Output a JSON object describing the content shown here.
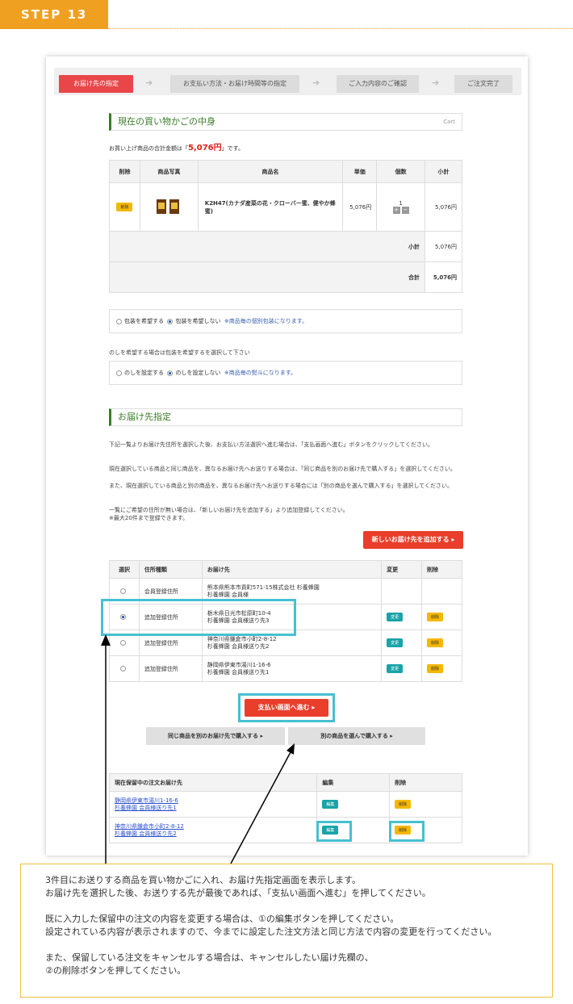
{
  "step": {
    "label": "STEP 13"
  },
  "progress": [
    "お届け先の指定",
    "お支払い方法・お届け時間等の指定",
    "ご入力内容のご確認",
    "ご注文完了"
  ],
  "cart_section": {
    "title": "現在の買い物かごの中身",
    "cart_tag": "Cart",
    "total_prefix": "お買い上げ商品の合計金額は「",
    "total_amount": "5,076円",
    "total_suffix": "」です。",
    "headers": [
      "削除",
      "商品写真",
      "商品名",
      "単価",
      "個数",
      "小計"
    ],
    "item": {
      "delete": "削除",
      "name": "K2H47(カナダ産菜の花・クローバー蜜、健やか蜂蜜)",
      "unit_price": "5,076円",
      "qty": "1",
      "subtotal": "5,076円"
    },
    "subtotal_label": "小計",
    "subtotal_value": "5,076円",
    "grand_label": "合計",
    "grand_value": "5,076円"
  },
  "wrap": {
    "opt1": "包装を希望する",
    "opt2": "包装を希望しない",
    "note": "※商品毎の個別包装になります。"
  },
  "noshi": {
    "hint": "のしを希望する場合は包装を希望するを選択して下さい",
    "opt1": "のしを設定する",
    "opt2": "のしを設定しない",
    "note": "※商品毎の熨斗になります。"
  },
  "delivery": {
    "title": "お届け先指定",
    "p1": "下記一覧よりお届け先住所を選択した後、お支払い方法選択へ進む場合は、「支払画面へ進む」ボタンをクリックしてください。",
    "p2a": "現在選択している商品と同じ商品を、異なるお届け先へお送りする場合は、「同じ商品を別のお届け先で購入する」を選択してください。",
    "p2b": "また、現在選択している商品と別の商品を、異なるお届け先へお送りする場合には「別の商品を選んで購入する」を選択してください。",
    "p3a": "一覧にご希望の住所が無い場合は、「新しいお届け先を追加する」より追加登録してください。",
    "p3b": "※最大20件まで登録できます。",
    "add_button": "新しいお届け先を追加する ▸",
    "headers": [
      "選択",
      "住所種類",
      "お届け先",
      "変更",
      "削除"
    ],
    "rows": [
      {
        "type": "会員登録住所",
        "addr1": "熊本県熊本市貢町571-15株式会社 杉養蜂園",
        "addr2": "杉養蜂園 会員様",
        "edit": "",
        "del": ""
      },
      {
        "type": "追加登録住所",
        "addr1": "栃木県日光市松原町10-4",
        "addr2": "杉養蜂園 会員様送り先3",
        "edit": "変更",
        "del": "削除"
      },
      {
        "type": "追加登録住所",
        "addr1": "神奈川県鎌倉市小町2-8-12",
        "addr2": "杉養蜂園 会員様送り先2",
        "edit": "変更",
        "del": "削除"
      },
      {
        "type": "追加登録住所",
        "addr1": "静岡県伊東市湯川1-16-6",
        "addr2": "杉養蜂園 会員様送り先1",
        "edit": "変更",
        "del": "削除"
      }
    ],
    "pay_button": "支払い画面へ進む ▸",
    "same_button": "同じ商品を別のお届け先で購入する ▸",
    "other_button": "別の商品を選んで購入する ▸"
  },
  "pending": {
    "headers": [
      "現在保留中の注文お届け先",
      "編集",
      "削除"
    ],
    "rows": [
      {
        "addr1": "静岡県伊東市湯川1-16-6",
        "addr2": "杉養蜂園 会員様送り先1",
        "edit": "編集",
        "del": "削除"
      },
      {
        "addr1": "神奈川県鎌倉市小町2-8-12",
        "addr2": "杉養蜂園 会員様送り先2",
        "edit": "編集",
        "del": "削除"
      }
    ]
  },
  "explanation": {
    "l1": "3件目にお送りする商品を買い物かごに入れ、お届け先指定画面を表示します。",
    "l2": "お届け先を選択した後、お送りする先が最後であれば、「支払い画面へ進む」を押してください。",
    "l3": "既に入力した保留中の注文の内容を変更する場合は、①の編集ボタンを押してください。",
    "l4": "設定されている内容が表示されますので、今までに設定した注文方法と同じ方法で内容の変更を行ってください。",
    "l5": "また、保留している注文をキャンセルする場合は、キャンセルしたい届け先欄の、",
    "l6": "②の削除ボタンを押してください。"
  }
}
